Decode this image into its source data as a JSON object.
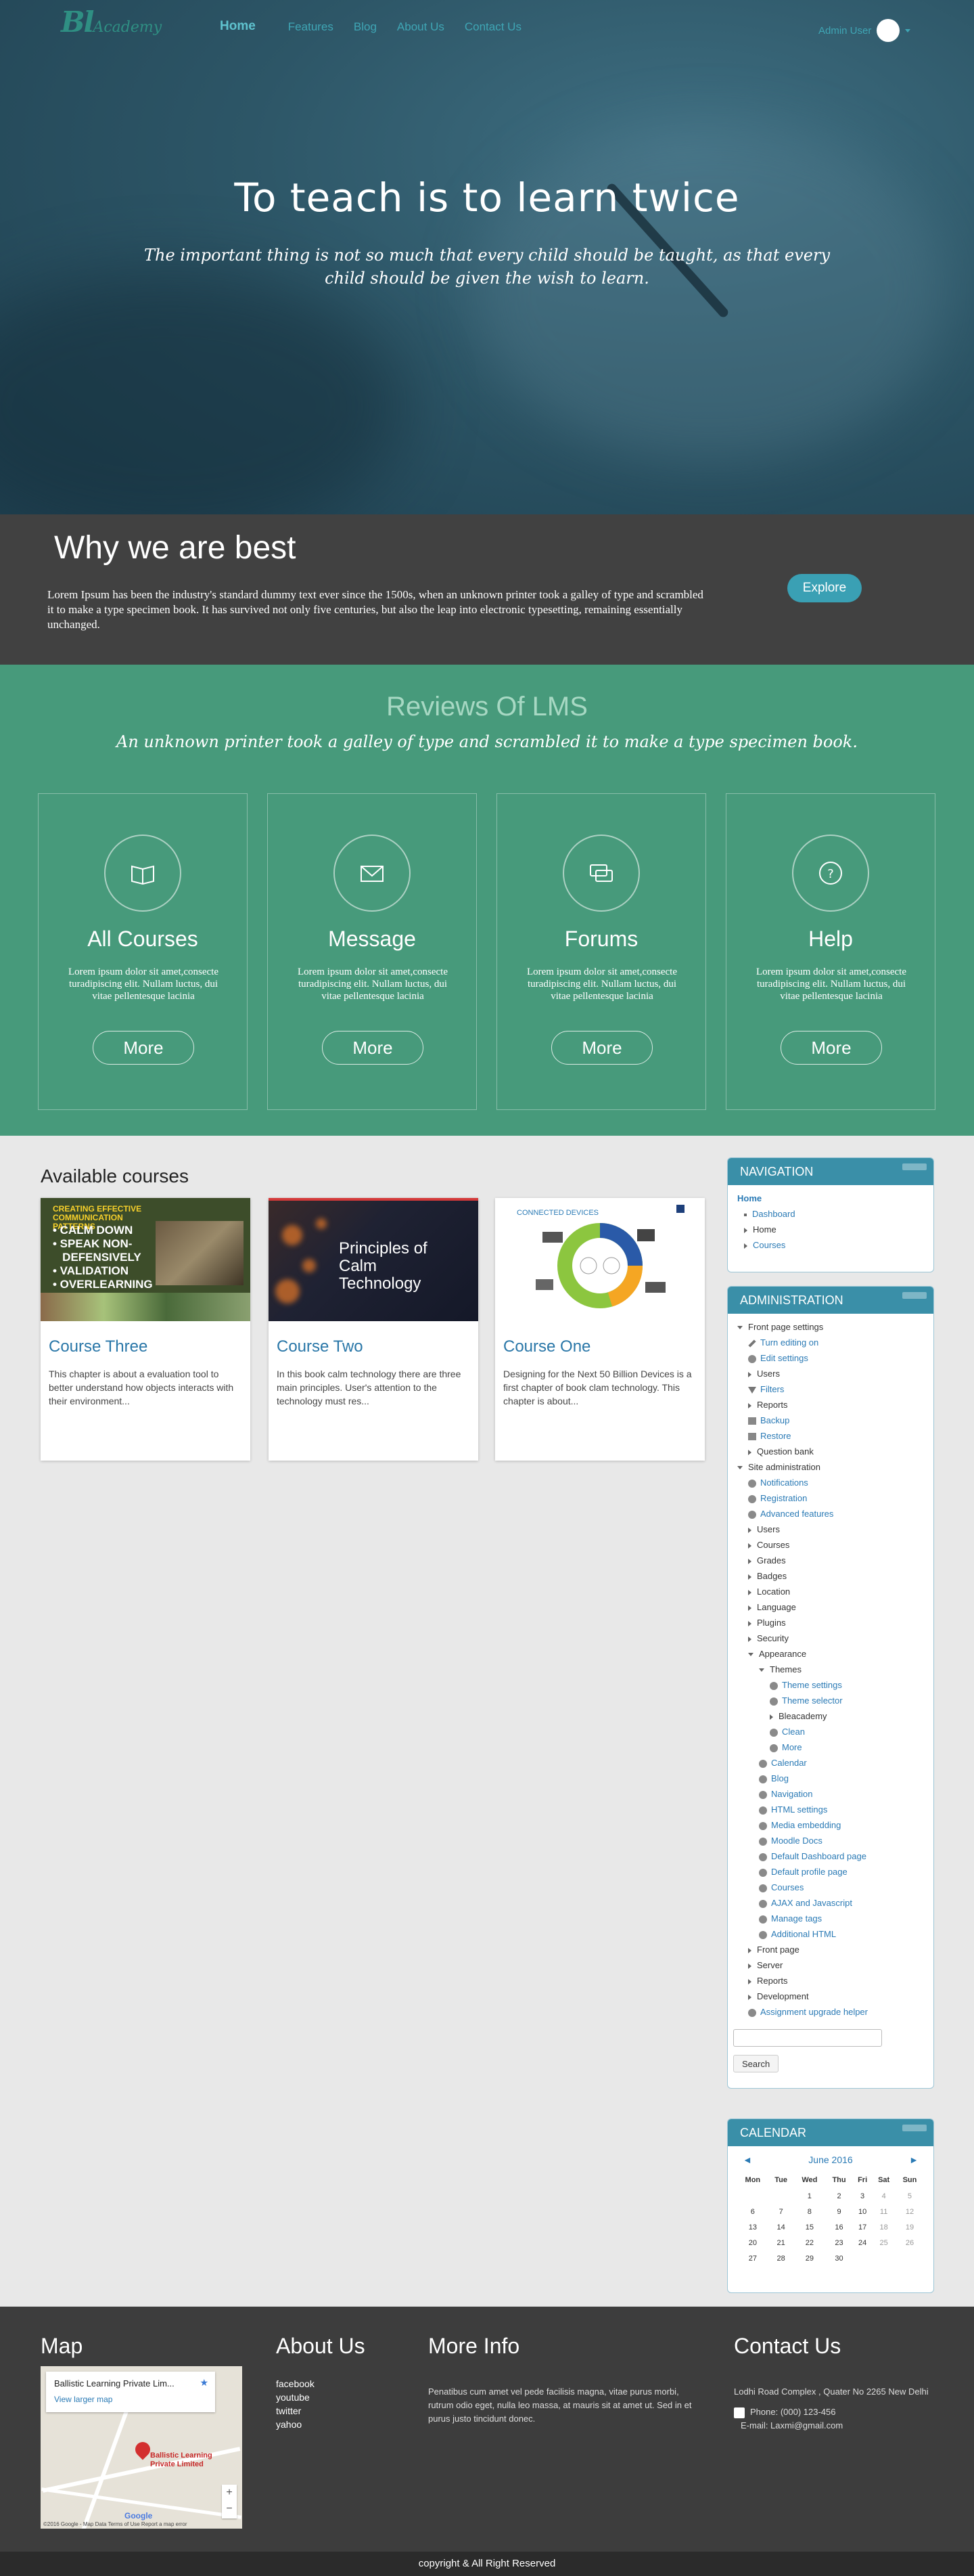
{
  "brand": {
    "bl": "Bl",
    "academy": "Academy"
  },
  "nav": {
    "items": [
      "Home",
      "Features",
      "Blog",
      "About Us",
      "Contact Us"
    ]
  },
  "user": {
    "name": "Admin User"
  },
  "hero": {
    "title": "To teach is to learn twice",
    "subtitle": "The important thing is not so much that every child should be taught, as that every child should be given the wish to learn."
  },
  "why": {
    "title": "Why we are best",
    "text": "Lorem Ipsum has been the industry's standard dummy text ever since the 1500s, when an unknown printer took a galley of type and scrambled it to make a type specimen book. It has survived not only five centuries, but also the leap into electronic typesetting, remaining essentially unchanged.",
    "button": "Explore"
  },
  "reviews": {
    "title": "Reviews Of LMS",
    "tagline": "An unknown printer took a galley of type and scrambled it to make a type specimen book.",
    "cards": [
      {
        "title": "All Courses",
        "text": "Lorem ipsum dolor sit amet,consecte turadipiscing elit. Nullam luctus, dui vitae pellentesque lacinia",
        "button": "More",
        "icon": "book-icon"
      },
      {
        "title": "Message",
        "text": "Lorem ipsum dolor sit amet,consecte turadipiscing elit. Nullam luctus, dui vitae pellentesque lacinia",
        "button": "More",
        "icon": "envelope-icon"
      },
      {
        "title": "Forums",
        "text": "Lorem ipsum dolor sit amet,consecte turadipiscing elit. Nullam luctus, dui vitae pellentesque lacinia",
        "button": "More",
        "icon": "chat-icon"
      },
      {
        "title": "Help",
        "text": "Lorem ipsum dolor sit amet,consecte turadipiscing elit. Nullam luctus, dui vitae pellentesque lacinia",
        "button": "More",
        "icon": "question-icon"
      }
    ]
  },
  "courses": {
    "title": "Available courses",
    "items": [
      {
        "title": "Course Three",
        "text": "This chapter is about a evaluation tool to better understand how objects interacts with their environment...",
        "image_title": "CREATING EFFECTIVE COMMUNICATION PATTERNS",
        "image_bullets": [
          "• CALM DOWN",
          "• SPEAK NON-",
          "   DEFENSIVELY",
          "• VALIDATION",
          "• OVERLEARNING"
        ]
      },
      {
        "title": "Course Two",
        "text": "In this book calm technology there are three main principles. User's attention to the technology must res...",
        "image_title": "Principles of Calm Technology"
      },
      {
        "title": "Course One",
        "text": "Designing for the Next 50 Billion Devices is a first chapter of book clam technology. This chapter is about...",
        "image_title": "CONNECTED DEVICES"
      }
    ]
  },
  "navigation_block": {
    "title": "NAVIGATION",
    "items": [
      "Home",
      "Dashboard",
      "Home",
      "Courses"
    ]
  },
  "admin_block": {
    "title": "ADMINISTRATION",
    "items": [
      {
        "label": "Front page settings",
        "type": "open",
        "indent": 0
      },
      {
        "label": "Turn editing on",
        "type": "pen",
        "indent": 1
      },
      {
        "label": "Edit settings",
        "type": "gear",
        "indent": 1
      },
      {
        "label": "Users",
        "type": "tri",
        "indent": 1
      },
      {
        "label": "Filters",
        "type": "funnel",
        "indent": 1
      },
      {
        "label": "Reports",
        "type": "tri",
        "indent": 1
      },
      {
        "label": "Backup",
        "type": "bu",
        "indent": 1
      },
      {
        "label": "Restore",
        "type": "bu",
        "indent": 1
      },
      {
        "label": "Question bank",
        "type": "tri",
        "indent": 1
      },
      {
        "label": "Site administration",
        "type": "open",
        "indent": 0
      },
      {
        "label": "Notifications",
        "type": "gear",
        "indent": 1
      },
      {
        "label": "Registration",
        "type": "gear",
        "indent": 1
      },
      {
        "label": "Advanced features",
        "type": "gear",
        "indent": 1
      },
      {
        "label": "Users",
        "type": "tri",
        "indent": 1
      },
      {
        "label": "Courses",
        "type": "tri",
        "indent": 1
      },
      {
        "label": "Grades",
        "type": "tri",
        "indent": 1
      },
      {
        "label": "Badges",
        "type": "tri",
        "indent": 1
      },
      {
        "label": "Location",
        "type": "tri",
        "indent": 1
      },
      {
        "label": "Language",
        "type": "tri",
        "indent": 1
      },
      {
        "label": "Plugins",
        "type": "tri",
        "indent": 1
      },
      {
        "label": "Security",
        "type": "tri",
        "indent": 1
      },
      {
        "label": "Appearance",
        "type": "open",
        "indent": 1
      },
      {
        "label": "Themes",
        "type": "open",
        "indent": 2
      },
      {
        "label": "Theme settings",
        "type": "gear",
        "indent": 3
      },
      {
        "label": "Theme selector",
        "type": "gear",
        "indent": 3
      },
      {
        "label": "Bleacademy",
        "type": "tri",
        "indent": 3
      },
      {
        "label": "Clean",
        "type": "gear",
        "indent": 3
      },
      {
        "label": "More",
        "type": "gear",
        "indent": 3
      },
      {
        "label": "Calendar",
        "type": "gear",
        "indent": 2
      },
      {
        "label": "Blog",
        "type": "gear",
        "indent": 2
      },
      {
        "label": "Navigation",
        "type": "gear",
        "indent": 2
      },
      {
        "label": "HTML settings",
        "type": "gear",
        "indent": 2
      },
      {
        "label": "Media embedding",
        "type": "gear",
        "indent": 2
      },
      {
        "label": "Moodle Docs",
        "type": "gear",
        "indent": 2
      },
      {
        "label": "Default Dashboard page",
        "type": "gear",
        "indent": 2
      },
      {
        "label": "Default profile page",
        "type": "gear",
        "indent": 2
      },
      {
        "label": "Courses",
        "type": "gear",
        "indent": 2
      },
      {
        "label": "AJAX and Javascript",
        "type": "gear",
        "indent": 2
      },
      {
        "label": "Manage tags",
        "type": "gear",
        "indent": 2
      },
      {
        "label": "Additional HTML",
        "type": "gear",
        "indent": 2
      },
      {
        "label": "Front page",
        "type": "tri",
        "indent": 1
      },
      {
        "label": "Server",
        "type": "tri",
        "indent": 1
      },
      {
        "label": "Reports",
        "type": "tri",
        "indent": 1
      },
      {
        "label": "Development",
        "type": "tri",
        "indent": 1
      },
      {
        "label": "Assignment upgrade helper",
        "type": "gear",
        "indent": 1
      }
    ],
    "search_button": "Search"
  },
  "calendar": {
    "title": "CALENDAR",
    "month": "June 2016",
    "prev": "◄",
    "next": "►",
    "days": [
      "Mon",
      "Tue",
      "Wed",
      "Thu",
      "Fri",
      "Sat",
      "Sun"
    ],
    "weeks": [
      [
        "",
        "",
        "1",
        "2",
        "3",
        "4",
        "5"
      ],
      [
        "6",
        "7",
        "8",
        "9",
        "10",
        "11",
        "12"
      ],
      [
        "13",
        "14",
        "15",
        "16",
        "17",
        "18",
        "19"
      ],
      [
        "20",
        "21",
        "22",
        "23",
        "24",
        "25",
        "26"
      ],
      [
        "27",
        "28",
        "29",
        "30",
        "",
        "",
        ""
      ]
    ]
  },
  "footer": {
    "map_title": "Map",
    "map_card_name": "Ballistic Learning Private Lim...",
    "map_card_link": "View larger map",
    "map_pin_label": "Ballistic Learning Private Limited",
    "map_credit": "©2016 Google - Map Data   Terms of Use   Report a map error",
    "map_google": "Google",
    "about_title": "About Us",
    "about_links": [
      "facebook",
      "youtube",
      "twitter",
      "yahoo"
    ],
    "more_title": "More Info",
    "more_text": "Penatibus cum amet vel pede facilisis magna, vitae purus morbi, rutrum odio eget, nulla leo massa, at mauris sit at amet ut. Sed in et purus justo tincidunt donec.",
    "contact_title": "Contact Us",
    "contact_address": "Lodhi Road Complex , Quater No 2265 New Delhi",
    "contact_phone": "Phone: (000) 123-456",
    "contact_email": "E-mail: Laxmi@gmail.com",
    "copyright": "copyright & All Right Reserved"
  }
}
